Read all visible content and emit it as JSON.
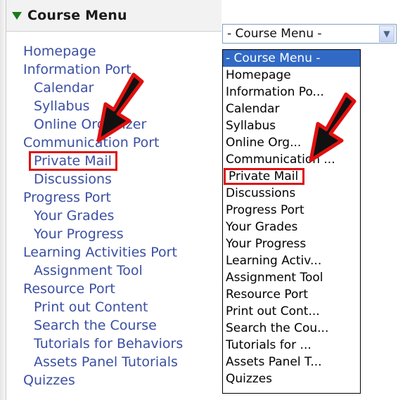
{
  "sidebar": {
    "title": "Course Menu",
    "items": [
      {
        "label": "Homepage",
        "indent": false,
        "highlighted": false
      },
      {
        "label": "Information Port",
        "indent": false,
        "highlighted": false
      },
      {
        "label": "Calendar",
        "indent": true,
        "highlighted": false
      },
      {
        "label": "Syllabus",
        "indent": true,
        "highlighted": false
      },
      {
        "label": "Online Organizer",
        "indent": true,
        "highlighted": false
      },
      {
        "label": "Communication Port",
        "indent": false,
        "highlighted": false
      },
      {
        "label": "Private Mail",
        "indent": true,
        "highlighted": true
      },
      {
        "label": "Discussions",
        "indent": true,
        "highlighted": false
      },
      {
        "label": "Progress Port",
        "indent": false,
        "highlighted": false
      },
      {
        "label": "Your Grades",
        "indent": true,
        "highlighted": false
      },
      {
        "label": "Your Progress",
        "indent": true,
        "highlighted": false
      },
      {
        "label": "Learning Activities Port",
        "indent": false,
        "highlighted": false
      },
      {
        "label": "Assignment Tool",
        "indent": true,
        "highlighted": false
      },
      {
        "label": "Resource Port",
        "indent": false,
        "highlighted": false
      },
      {
        "label": "Print out Content",
        "indent": true,
        "highlighted": false
      },
      {
        "label": "Search the Course",
        "indent": true,
        "highlighted": false
      },
      {
        "label": "Tutorials for Behaviors",
        "indent": true,
        "highlighted": false
      },
      {
        "label": "Assets Panel Tutorials",
        "indent": true,
        "highlighted": false
      },
      {
        "label": "Quizzes",
        "indent": false,
        "highlighted": false
      }
    ]
  },
  "dropdown": {
    "selected_value": "- Course Menu -",
    "options": [
      {
        "label": "- Course Menu -",
        "selected": true,
        "highlighted": false
      },
      {
        "label": "Homepage",
        "selected": false,
        "highlighted": false
      },
      {
        "label": "Information Po...",
        "selected": false,
        "highlighted": false
      },
      {
        "label": "Calendar",
        "selected": false,
        "highlighted": false
      },
      {
        "label": "Syllabus",
        "selected": false,
        "highlighted": false
      },
      {
        "label": "Online Org...",
        "selected": false,
        "highlighted": false
      },
      {
        "label": "Communication ...",
        "selected": false,
        "highlighted": false
      },
      {
        "label": "Private Mail",
        "selected": false,
        "highlighted": true
      },
      {
        "label": "Discussions",
        "selected": false,
        "highlighted": false
      },
      {
        "label": "Progress Port",
        "selected": false,
        "highlighted": false
      },
      {
        "label": "Your Grades",
        "selected": false,
        "highlighted": false
      },
      {
        "label": "Your Progress",
        "selected": false,
        "highlighted": false
      },
      {
        "label": "Learning Activ...",
        "selected": false,
        "highlighted": false
      },
      {
        "label": "Assignment Tool",
        "selected": false,
        "highlighted": false
      },
      {
        "label": "Resource Port",
        "selected": false,
        "highlighted": false
      },
      {
        "label": "Print out Cont...",
        "selected": false,
        "highlighted": false
      },
      {
        "label": "Search the Cou...",
        "selected": false,
        "highlighted": false
      },
      {
        "label": "Tutorials for ...",
        "selected": false,
        "highlighted": false
      },
      {
        "label": "Assets Panel T...",
        "selected": false,
        "highlighted": false
      },
      {
        "label": "Quizzes",
        "selected": false,
        "highlighted": false
      },
      {
        "label": "---------------",
        "selected": false,
        "highlighted": false
      }
    ]
  },
  "colors": {
    "link": "#3a4fa3",
    "highlight_box": "#e01010",
    "arrow_fill": "#111111",
    "arrow_outline": "#e01010",
    "selected_bg": "#316ac5",
    "menu_triangle": "#1a7a1a"
  },
  "icons": {
    "menu_toggle": "triangle-down-icon",
    "dropdown_button": "chevron-down-icon",
    "annotation": "arrow-icon"
  }
}
